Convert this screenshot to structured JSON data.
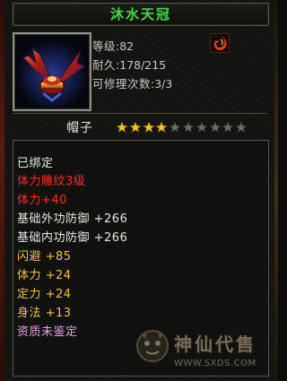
{
  "window": {
    "title": "沐水天冠"
  },
  "item": {
    "icon": "crown-helmet-icon",
    "level_label": "等级",
    "level_value": ":82",
    "durability_label": "耐久",
    "durability_value": ":178/215",
    "repair_label": "可修理次数",
    "repair_value": ":3/3",
    "type_name": "帽子",
    "stars_filled": 4,
    "stars_total": 10,
    "element_icon": "flame-swirl-icon"
  },
  "attributes": [
    {
      "text": "已绑定",
      "color": "white"
    },
    {
      "text": "体力雕纹3级",
      "color": "red"
    },
    {
      "text": "体力+40",
      "color": "red"
    },
    {
      "text": "基础外功防御 +266",
      "color": "white"
    },
    {
      "text": "基础内功防御 +266",
      "color": "white"
    },
    {
      "text": "闪避 +85",
      "color": "yellow"
    },
    {
      "text": "体力 +24",
      "color": "yellow"
    },
    {
      "text": "定力 +24",
      "color": "yellow"
    },
    {
      "text": "身法 +13",
      "color": "yellow"
    },
    {
      "text": "资质未鉴定",
      "color": "pink"
    }
  ],
  "watermark": {
    "text": "神仙代售",
    "url": "WWW.SXDS.COM",
    "icon": "mascot-logo-icon"
  },
  "colors": {
    "title": "#48d24a",
    "star_filled": "#f2c22e",
    "star_empty": "#6b6b6b"
  }
}
